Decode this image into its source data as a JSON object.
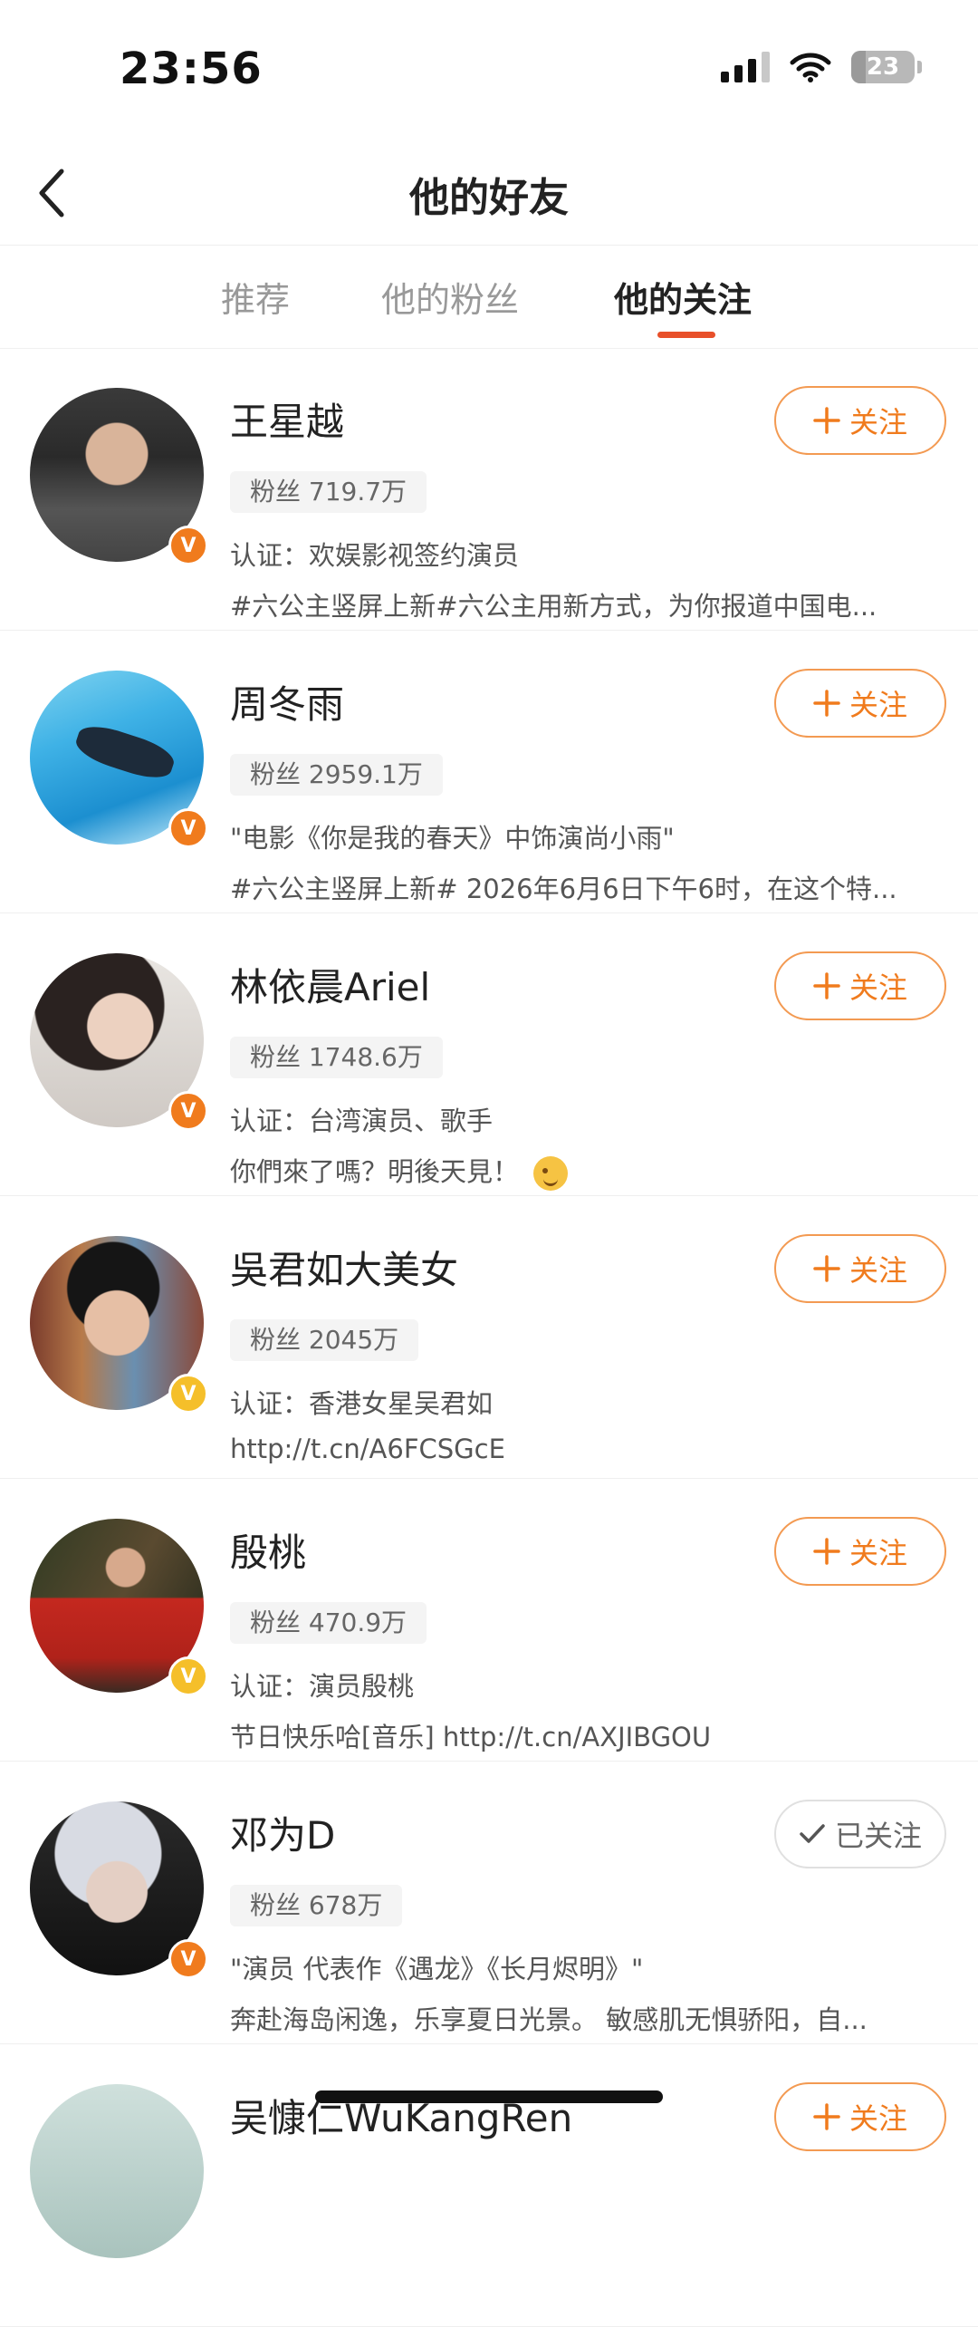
{
  "status_bar": {
    "time": "23:56",
    "battery": "23",
    "battery_level_percent": 23
  },
  "nav": {
    "title": "他的好友"
  },
  "tabs": [
    {
      "label": "推荐",
      "active": false
    },
    {
      "label": "他的粉丝",
      "active": false
    },
    {
      "label": "他的关注",
      "active": true
    }
  ],
  "follow_label": "关注",
  "followed_label": "已关注",
  "colors": {
    "accent": "#f07b1d",
    "tab_indicator": "#e8502a",
    "badge_orange": "#f07b1d",
    "badge_yellow": "#f5bf2a"
  },
  "users": [
    {
      "name": "王星越",
      "fans": "粉丝 719.7万",
      "desc": "认证：欢娱影视签约演员",
      "post": "#六公主竖屏上新#六公主用新方式，为你报道中国电...",
      "followed": false,
      "badge": "orange"
    },
    {
      "name": "周冬雨",
      "fans": "粉丝 2959.1万",
      "desc": "\"电影《你是我的春天》中饰演尚小雨\"",
      "post": "#六公主竖屏上新# 2026年6月6日下午6时，在这个特...",
      "followed": false,
      "badge": "orange"
    },
    {
      "name": "林依晨Ariel",
      "fans": "粉丝 1748.6万",
      "desc": "认证：台湾演员、歌手",
      "post": "你們來了嗎？明後天見！",
      "followed": false,
      "badge": "orange"
    },
    {
      "name": "吳君如大美女",
      "fans": "粉丝 2045万",
      "desc": "认证：香港女星吴君如",
      "post": "http://t.cn/A6FCSGcE",
      "followed": false,
      "badge": "yellow"
    },
    {
      "name": "殷桃",
      "fans": "粉丝 470.9万",
      "desc": "认证：演员殷桃",
      "post": "节日快乐哈[音乐] http://t.cn/AXJIBGOU",
      "followed": false,
      "badge": "yellow"
    },
    {
      "name": "邓为D",
      "fans": "粉丝 678万",
      "desc": "\"演员 代表作《遇龙》《长月烬明》\"",
      "post": "奔赴海岛闲逸，乐享夏日光景。 敏感肌无惧骄阳，自...",
      "followed": true,
      "badge": "orange"
    },
    {
      "name": "吴慷仁WuKangRen",
      "followed": false
    }
  ]
}
